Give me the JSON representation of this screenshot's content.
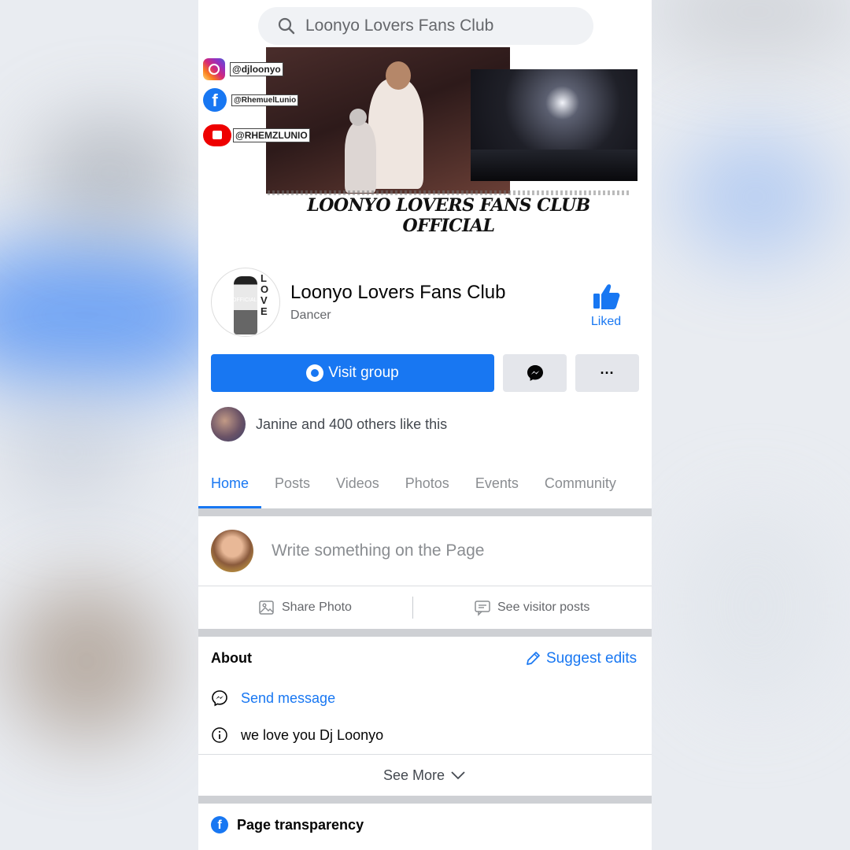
{
  "search": {
    "value": "Loonyo Lovers Fans Club"
  },
  "cover": {
    "social_handles": [
      {
        "icon": "instagram-icon",
        "handle": "@djloonyo"
      },
      {
        "icon": "facebook-icon",
        "handle": "@RhemuelLunio"
      },
      {
        "icon": "youtube-icon",
        "handle": "@RHEMZLUNIO"
      }
    ],
    "title": "LOONYO LOVERS FANS CLUB OFFICIAL"
  },
  "profile": {
    "name": "Loonyo Lovers Fans Club",
    "category": "Dancer",
    "like_label": "Liked",
    "avatar_letters": "L O V E",
    "avatar_shirt": "OFFICIAL"
  },
  "buttons": {
    "visit_group": "Visit group",
    "more": "···"
  },
  "likes": {
    "text": "Janine and 400 others like this"
  },
  "tabs": [
    "Home",
    "Posts",
    "Videos",
    "Photos",
    "Events",
    "Community"
  ],
  "composer": {
    "placeholder": "Write something on the Page",
    "share_photo": "Share Photo",
    "see_visitor_posts": "See visitor posts"
  },
  "about": {
    "heading": "About",
    "suggest_edits": "Suggest edits",
    "send_message": "Send message",
    "description": "we love you Dj Loonyo",
    "see_more": "See More"
  },
  "transparency": {
    "heading": "Page transparency"
  },
  "colors": {
    "accent": "#1877f2",
    "text": "#050505",
    "muted": "#65676b"
  }
}
